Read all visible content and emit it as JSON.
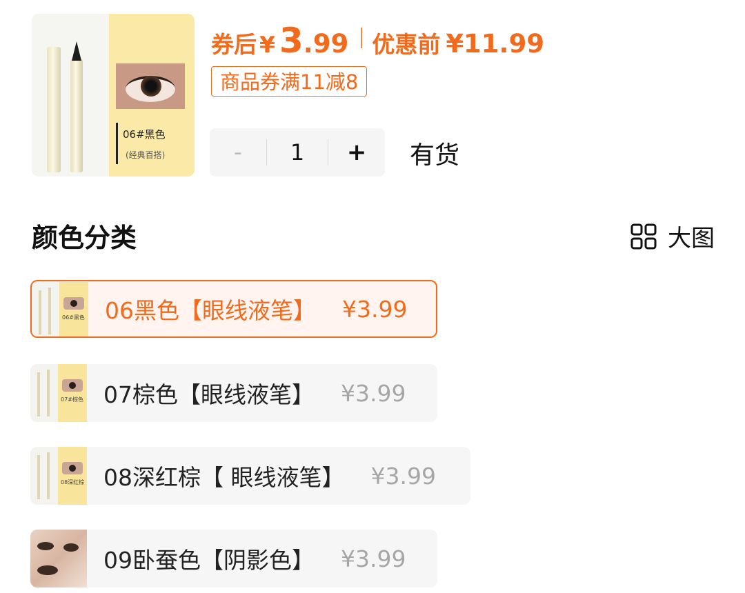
{
  "product": {
    "thumbnail_label": "06#黑色",
    "thumbnail_sublabel": "(经典百搭)"
  },
  "price": {
    "coupon_after_label": "券后",
    "currency": "¥",
    "int_part": "3",
    "dec_part": ".99",
    "pre_label": "优惠前",
    "pre_price": "¥11.99",
    "color": "#f26a1b"
  },
  "coupon": {
    "text": "商品券满11减8"
  },
  "quantity": {
    "minus": "-",
    "value": "1",
    "plus": "+"
  },
  "stock": "有货",
  "section": {
    "title": "颜色分类",
    "big_view_label": "大图",
    "big_view_icon": "grid-icon"
  },
  "variants": [
    {
      "name": "06黑色【眼线液笔】",
      "price": "¥3.99",
      "selected": true,
      "thumb_text": "06#黑色"
    },
    {
      "name": "07棕色【眼线液笔】",
      "price": "¥3.99",
      "selected": false,
      "thumb_text": "07#棕色"
    },
    {
      "name": "08深红棕【 眼线液笔】",
      "price": "¥3.99",
      "selected": false,
      "thumb_text": "08深红棕"
    },
    {
      "name": "09卧蚕色【阴影色】",
      "price": "¥3.99",
      "selected": false,
      "thumb_text": ""
    }
  ]
}
